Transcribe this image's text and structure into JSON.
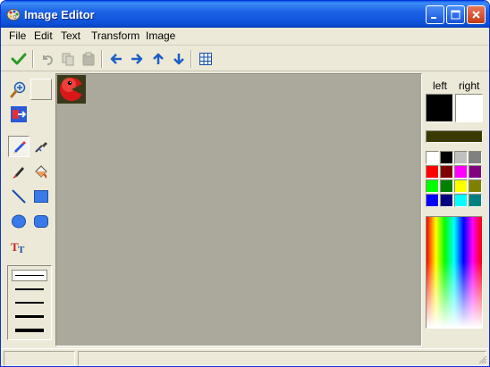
{
  "window": {
    "title": "Image Editor"
  },
  "caption_buttons": [
    {
      "name": "minimize-button",
      "icon": "minimize-icon"
    },
    {
      "name": "maximize-button",
      "icon": "maximize-icon"
    },
    {
      "name": "close-button",
      "icon": "close-icon"
    }
  ],
  "menu": [
    "File",
    "Edit",
    "Text",
    "Transform",
    "Image"
  ],
  "toolbar": [
    {
      "name": "apply-button",
      "icon": "checkmark-icon",
      "enabled": true
    },
    {
      "name": "undo-button",
      "icon": "undo-icon",
      "enabled": false
    },
    {
      "name": "copy-button",
      "icon": "copy-icon",
      "enabled": false
    },
    {
      "name": "paste-button",
      "icon": "paste-icon",
      "enabled": false
    },
    {
      "name": "shift-left-button",
      "icon": "arrow-left-icon",
      "enabled": true
    },
    {
      "name": "shift-right-button",
      "icon": "arrow-right-icon",
      "enabled": true
    },
    {
      "name": "shift-up-button",
      "icon": "arrow-up-icon",
      "enabled": true
    },
    {
      "name": "shift-down-button",
      "icon": "arrow-down-icon",
      "enabled": true
    },
    {
      "name": "grid-button",
      "icon": "grid-icon",
      "enabled": true
    }
  ],
  "tools": [
    {
      "name": "zoom-tool",
      "icon": "magnifier-icon"
    },
    {
      "name": "blank-tool",
      "icon": ""
    },
    {
      "name": "flip-tool",
      "icon": "flip-icon"
    },
    {
      "name": "pencil-tool",
      "icon": "pencil-icon",
      "selected": true
    },
    {
      "name": "color-picker-tool",
      "icon": "eyedropper-icon"
    },
    {
      "name": "brush-tool",
      "icon": "brush-icon"
    },
    {
      "name": "fill-tool",
      "icon": "fill-bucket-icon"
    },
    {
      "name": "line-tool",
      "icon": "line-icon"
    },
    {
      "name": "rectangle-tool",
      "icon": "rectangle-icon"
    },
    {
      "name": "ellipse-tool",
      "icon": "ellipse-icon"
    },
    {
      "name": "rounded-rectangle-tool",
      "icon": "rounded-rectangle-icon"
    },
    {
      "name": "text-tool",
      "icon": "text-icon"
    }
  ],
  "line_widths": [
    1,
    2,
    3,
    4,
    5
  ],
  "palette": {
    "left_label": "left",
    "right_label": "right",
    "left_color": "#000000",
    "right_color": "#ffffff",
    "current_color": "#3a3a00",
    "swatches": [
      "#ffffff",
      "#000000",
      "#c0c0c0",
      "#808080",
      "#ff0000",
      "#800000",
      "#ff00ff",
      "#800080",
      "#00ff00",
      "#008000",
      "#ffff00",
      "#808000",
      "#0000ff",
      "#000080",
      "#00ffff",
      "#008080"
    ]
  },
  "canvas": {
    "background": "#aba89c",
    "image_background": "#3a3a1a",
    "image_subject": "red-pacman-icon"
  },
  "status": {
    "left": "",
    "right": ""
  }
}
